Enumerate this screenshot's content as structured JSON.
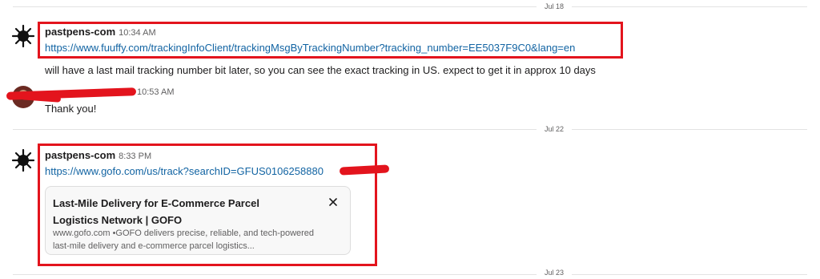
{
  "dates": {
    "d1": "Jul 18",
    "d2": "Jul 22",
    "d3": "Jul 23"
  },
  "messages": [
    {
      "author": "pastpens-com",
      "time": "10:34 AM",
      "link": "https://www.fuuffy.com/trackingInfoClient/trackingMsgByTrackingNumber?tracking_number=EE5037F9C0&lang=en",
      "text": "will have a last mail tracking number bit later, so you can see the exact tracking in US. expect to get it in approx 10 days"
    },
    {
      "author": "",
      "time": "10:53 AM",
      "text": "Thank you!"
    },
    {
      "author": "pastpens-com",
      "time": "8:33 PM",
      "link": "https://www.gofo.com/us/track?searchID=GFUS0106258880",
      "preview": {
        "title": "Last-Mile Delivery for E-Commerce Parcel Logistics Network | GOFO",
        "description": "www.gofo.com •GOFO delivers precise, reliable, and tech-powered last-mile delivery and e-commerce parcel logistics...",
        "close_icon": "close-icon"
      }
    }
  ],
  "colors": {
    "accent_link": "#1264a3",
    "highlight": "#e3141d"
  }
}
